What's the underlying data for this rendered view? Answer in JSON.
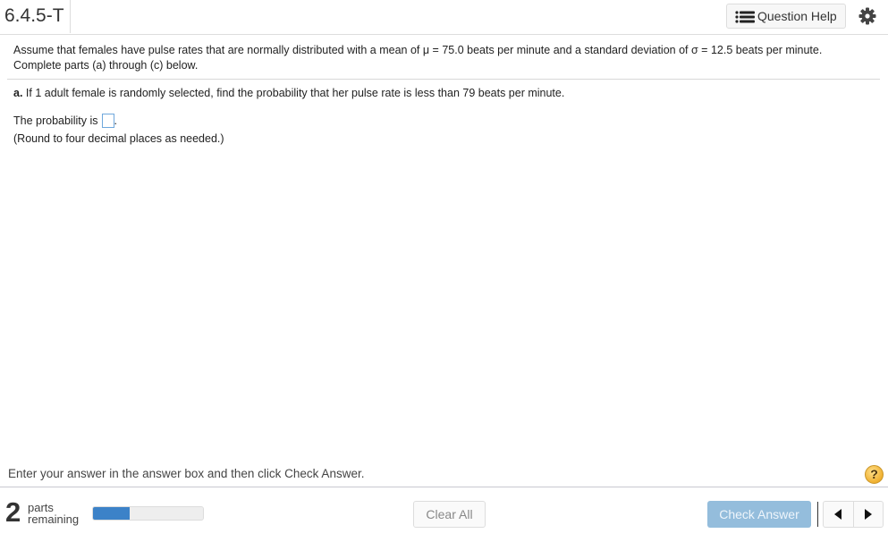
{
  "header": {
    "question_id": "6.4.5-T",
    "question_help_label": "Question Help",
    "icons": {
      "question_help": "list-icon",
      "settings": "gear-icon"
    }
  },
  "question": {
    "stem_line1": "Assume that females have pulse rates that are normally distributed with a mean of μ = 75.0 beats per minute and a standard deviation of σ = 12.5 beats per minute.",
    "stem_line2": "Complete parts (a) through (c) below.",
    "part_a_label": "a.",
    "part_a_text": " If 1 adult female is randomly selected, find the probability that her pulse rate is less than 79 beats per minute.",
    "answer_prefix": "The probability is",
    "answer_value": "",
    "answer_suffix": ".",
    "rounding_note": "(Round to four decimal places as needed.)"
  },
  "footer": {
    "instruction": "Enter your answer in the answer box and then click Check Answer.",
    "help_symbol": "?",
    "parts_remaining_count": "2",
    "parts_label_1": "parts",
    "parts_label_2": "remaining",
    "progress_fraction": 0.33,
    "progress_color": "#3c82c8",
    "clear_all_label": "Clear All",
    "check_answer_label": "Check Answer",
    "check_answer_color": "#94bddc"
  }
}
